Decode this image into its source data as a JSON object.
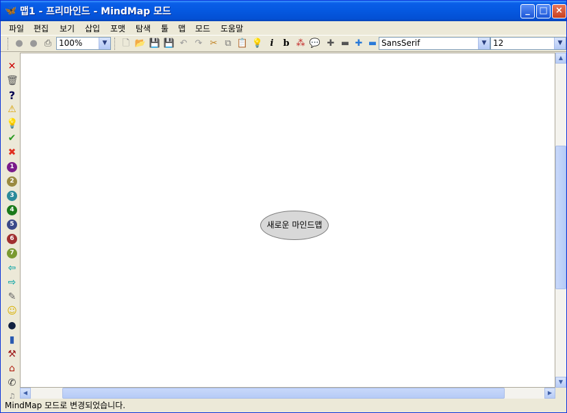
{
  "window": {
    "title": "맵1 - 프리마인드 - MindMap 모드",
    "app_icon": "butterfly-icon"
  },
  "menu": [
    "파일",
    "편집",
    "보기",
    "삽입",
    "포맷",
    "탐색",
    "툴",
    "맵",
    "모드",
    "도움말"
  ],
  "toolbar": {
    "zoom": "100%",
    "font_family": "SansSerif",
    "font_size": "12",
    "italic_label": "i",
    "bold_label": "b"
  },
  "left_icons": [
    "close-red-x-icon",
    "trash-icon",
    "question-icon",
    "warning-icon",
    "lightbulb-icon",
    "checkmark-icon",
    "cross-icon",
    "priority-1-icon",
    "priority-2-icon",
    "priority-3-icon",
    "priority-4-icon",
    "priority-5-icon",
    "priority-6-icon",
    "priority-7-icon",
    "arrow-left-icon",
    "arrow-right-icon",
    "pencil-icon",
    "smiley-icon",
    "bomb-icon",
    "book-icon",
    "hammer-icon",
    "home-icon",
    "phone-icon",
    "music-icon"
  ],
  "priority_labels": [
    "1",
    "2",
    "3",
    "4",
    "5",
    "6",
    "7"
  ],
  "mindmap": {
    "root_node": "새로운 마인드맵"
  },
  "status": "MindMap 모드로 변경되었습니다."
}
